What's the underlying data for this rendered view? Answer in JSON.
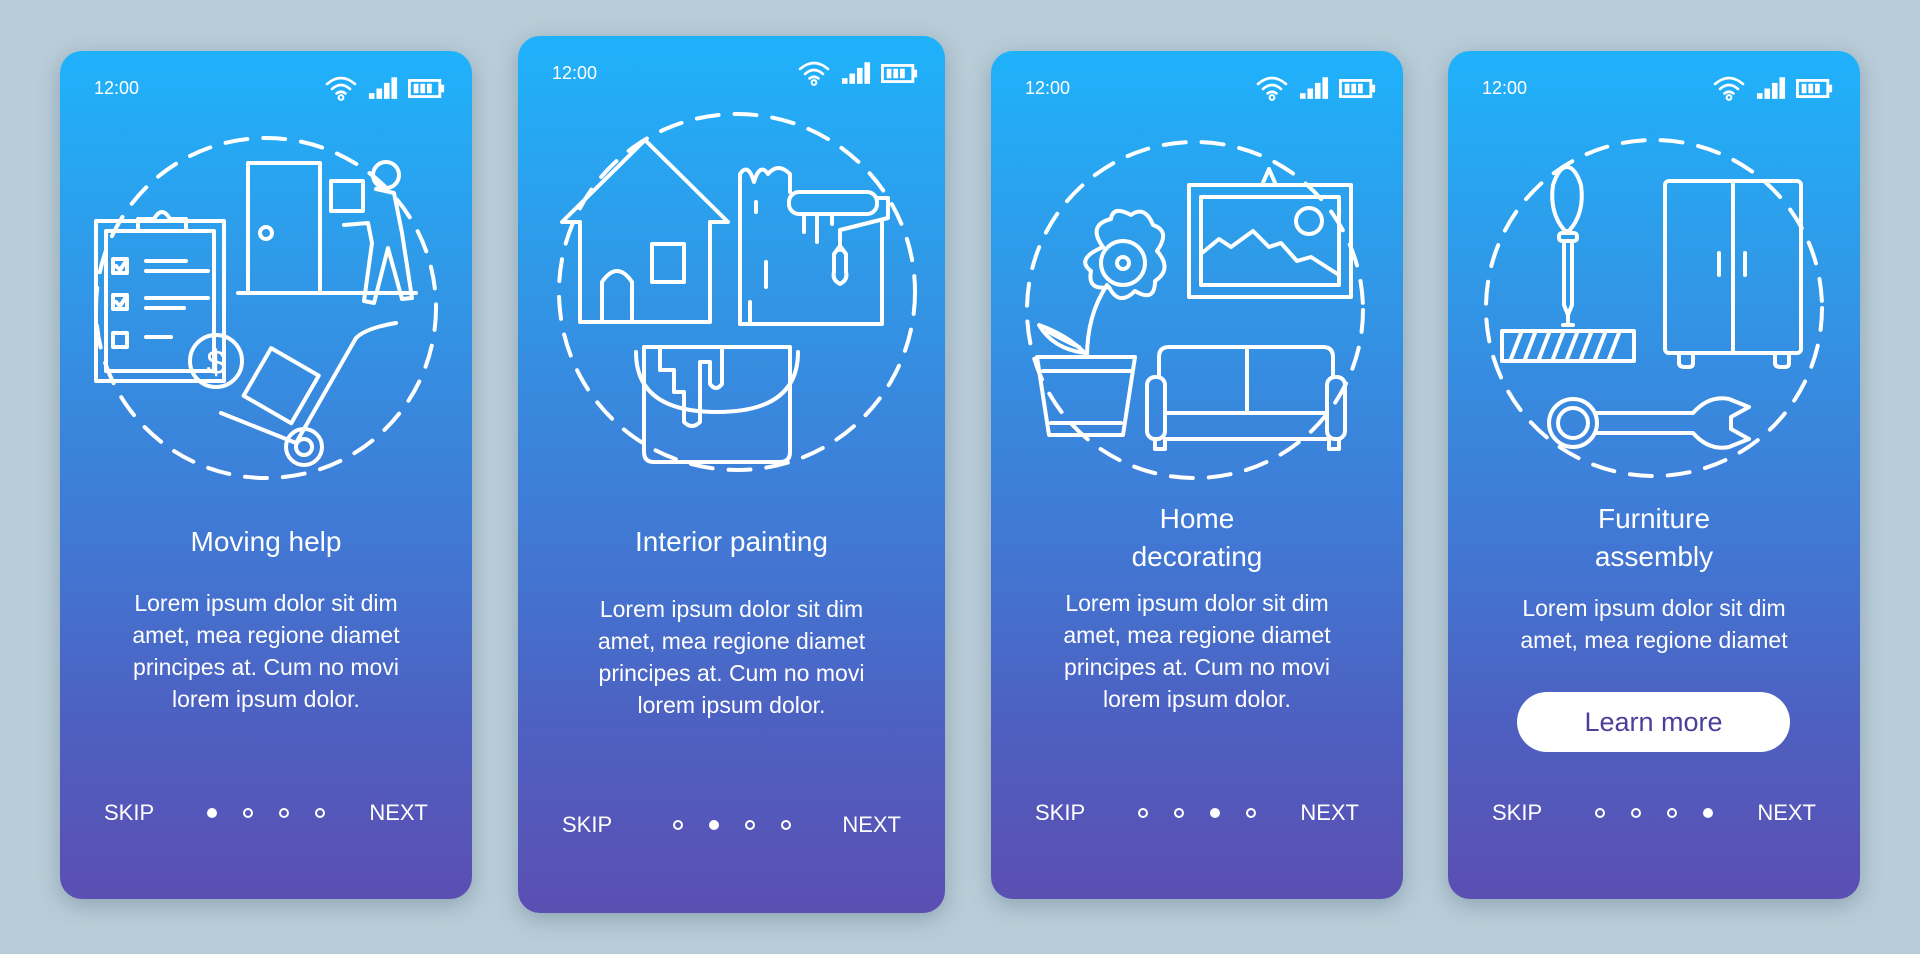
{
  "theme": {
    "background": "#b9cdd8",
    "gradient_top": "#1fb2fb",
    "gradient_bottom": "#5b4fb2",
    "button_text": "#4b3f9c"
  },
  "screens": [
    {
      "status": {
        "time": "12:00",
        "icons": [
          "wifi-icon",
          "signal-icon",
          "battery-icon"
        ]
      },
      "illustration": "moving-help-illustration",
      "title_lines": [
        "Moving help"
      ],
      "body_lines": [
        "Lorem ipsum dolor sit dim",
        "amet, mea regione diamet",
        "principes at. Cum no movi",
        "lorem ipsum dolor."
      ],
      "nav": {
        "skip": "SKIP",
        "next": "NEXT",
        "page_count": 4,
        "active_page": 1
      }
    },
    {
      "status": {
        "time": "12:00",
        "icons": [
          "wifi-icon",
          "signal-icon",
          "battery-icon"
        ]
      },
      "illustration": "interior-painting-illustration",
      "title_lines": [
        "Interior painting"
      ],
      "body_lines": [
        "Lorem ipsum dolor sit dim",
        "amet, mea regione diamet",
        "principes at. Cum no movi",
        "lorem ipsum dolor."
      ],
      "nav": {
        "skip": "SKIP",
        "next": "NEXT",
        "page_count": 4,
        "active_page": 2
      }
    },
    {
      "status": {
        "time": "12:00",
        "icons": [
          "wifi-icon",
          "signal-icon",
          "battery-icon"
        ]
      },
      "illustration": "home-decorating-illustration",
      "title_lines": [
        "Home",
        "decorating"
      ],
      "body_lines": [
        "Lorem ipsum dolor sit dim",
        "amet, mea regione diamet",
        "principes at. Cum no movi",
        "lorem ipsum dolor."
      ],
      "nav": {
        "skip": "SKIP",
        "next": "NEXT",
        "page_count": 4,
        "active_page": 3
      }
    },
    {
      "status": {
        "time": "12:00",
        "icons": [
          "wifi-icon",
          "signal-icon",
          "battery-icon"
        ]
      },
      "illustration": "furniture-assembly-illustration",
      "title_lines": [
        "Furniture",
        "assembly"
      ],
      "body_lines": [
        "Lorem ipsum dolor sit dim",
        "amet, mea regione diamet"
      ],
      "button": "Learn more",
      "nav": {
        "skip": "SKIP",
        "next": "NEXT",
        "page_count": 4,
        "active_page": 4
      }
    }
  ]
}
